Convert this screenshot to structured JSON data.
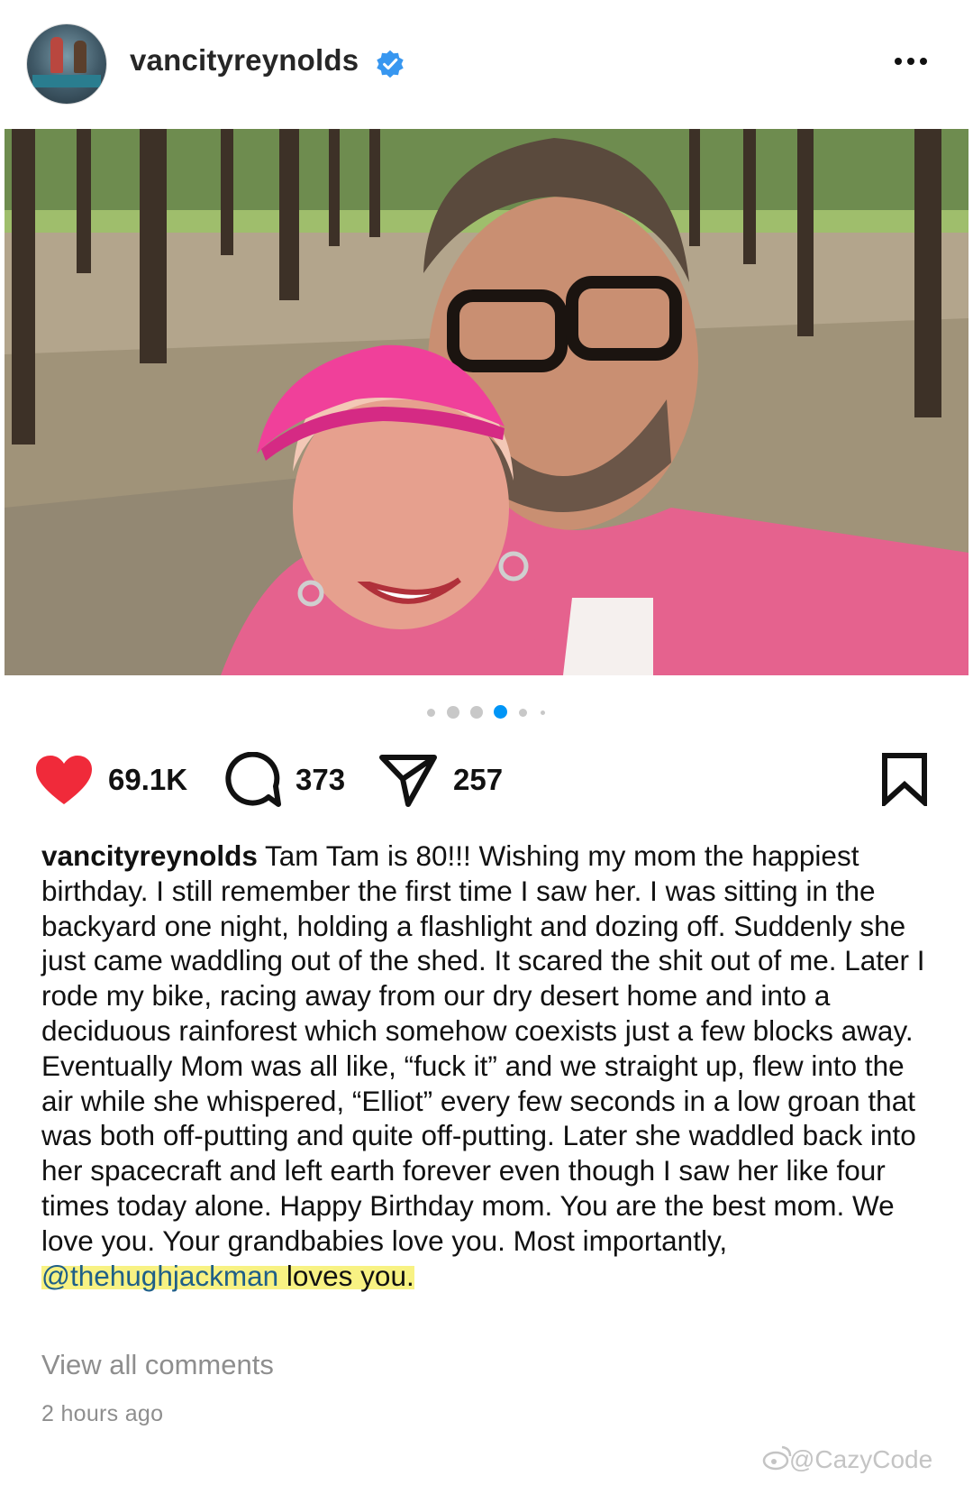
{
  "post": {
    "username": "vancityreynolds",
    "likes": "69.1K",
    "comments": "373",
    "shares": "257",
    "carousel": {
      "total": 6,
      "active_index": 3
    },
    "caption": {
      "username": "vancityreynolds",
      "text_part1": " Tam Tam is 80!!! Wishing my mom the happiest birthday. I still remember the first time I saw her. I was sitting in the backyard one night, holding a flashlight and dozing off. Suddenly she just came waddling out of the shed. It scared the shit out of me. Later I rode my bike, racing away from our dry desert home and into a deciduous rainforest which somehow coexists just a few blocks away. Eventually Mom was all like, “fuck it” and we straight up, flew into the air while she whispered, “Elliot” every few seconds in a low groan that was both off-putting and quite off-putting. Later she waddled back into her spacecraft and left earth forever even though I saw her like four times today alone. Happy Birthday mom. You are the best mom. We love you. Your grandbabies love you. Most importantly, ",
      "mention": "@thehughjackman",
      "text_part2": " loves you."
    },
    "view_all_comments": "View all comments",
    "timestamp": "2 hours ago"
  },
  "watermark": "@CazyCode",
  "colors": {
    "like_red": "#f02a3a",
    "verified_blue": "#3897f0",
    "active_dot": "#0095f6",
    "mention_text": "#1f5f88",
    "highlight": "#f8f283"
  },
  "icons": {
    "verified": "verified-badge-icon",
    "more": "more-options-icon",
    "like": "heart-filled-icon",
    "comment": "comment-bubble-icon",
    "share": "paper-plane-icon",
    "save": "bookmark-icon"
  }
}
